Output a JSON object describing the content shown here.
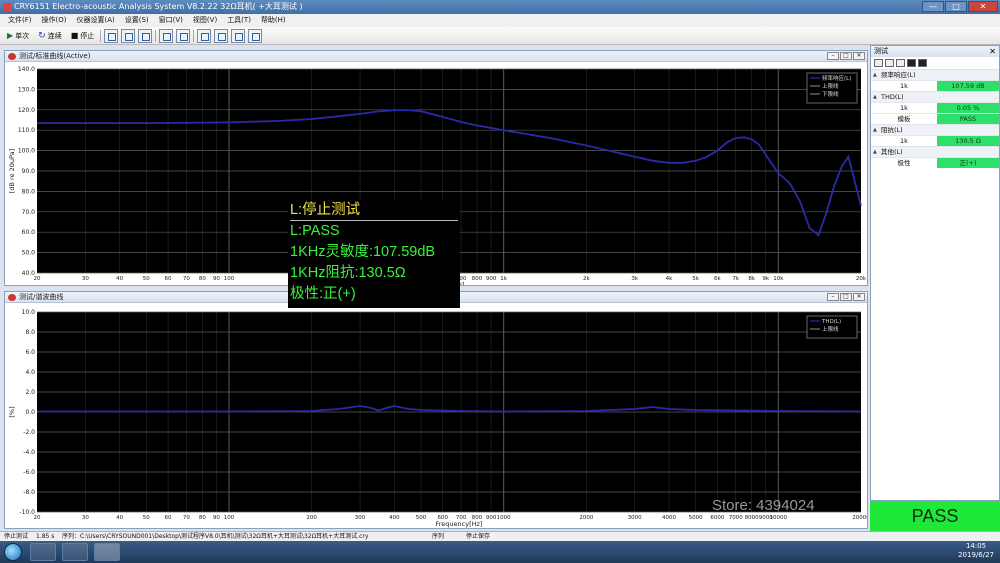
{
  "titlebar": {
    "title": "CRY6151 Electro-acoustic Analysis System  V8.2.22 32Ω耳机( +大耳测试 )",
    "min": "—",
    "max": "□",
    "close": "✕"
  },
  "menu": [
    "文件(F)",
    "操作(O)",
    "仪器设置(A)",
    "设置(S)",
    "窗口(V)",
    "视图(V)",
    "工具(T)",
    "帮助(H)"
  ],
  "toolbar": {
    "single": "单次",
    "continuous": "连续",
    "stop": "停止"
  },
  "panel_top": {
    "title": "测试/标准曲线(Active)",
    "ylabel": "[dB re 20uPa]",
    "xlabel_partial": "Hz]"
  },
  "panel_bottom": {
    "title": "测试/谐波曲线",
    "ylabel": "[%]",
    "xlabel": "Frequency[Hz]"
  },
  "legend_top": [
    "频率响应(L)",
    "上限线",
    "下限线"
  ],
  "legend_bottom": [
    "THD(L)",
    "上限线"
  ],
  "overlay": {
    "line1": "L:停止测试",
    "line2": "L:PASS",
    "line3": "1KHz灵敏度:107.59dB",
    "line4": "1KHz阻抗:130.5Ω",
    "line5": "极性:正(+)"
  },
  "right_panel": {
    "title": "测试",
    "close": "✕",
    "groups": [
      {
        "title": "频率响应(L)",
        "rows": [
          {
            "k": "1k",
            "v": "107.59 dB"
          }
        ]
      },
      {
        "title": "THD(L)",
        "rows": [
          {
            "k": "1k",
            "v": "0.05 %"
          },
          {
            "k": "模板",
            "v": "PASS"
          }
        ]
      },
      {
        "title": "阻抗(L)",
        "rows": [
          {
            "k": "1k",
            "v": "130.5 Ω"
          }
        ]
      },
      {
        "title": "其他(L)",
        "rows": [
          {
            "k": "极性",
            "v": "正(+)"
          }
        ]
      }
    ]
  },
  "pass_label": "PASS",
  "watermark": "Store: 4394024",
  "statusbar": {
    "status": "停止测试",
    "time": "1.85 s",
    "path": "序列：C:\\Users\\CRYSOUND001\\Desktop\\测试程序V8.0\\耳机\\测试\\32Ω耳机+大耳测试\\32Ω耳机+大耳测试.cry",
    "seq": "序列",
    "state": "停止保存"
  },
  "taskbar": {
    "time": "14:05",
    "date": "2019/6/27"
  },
  "colors": {
    "curve": "#2a2aa8",
    "grid_major": "#5a5a5a",
    "grid_minor": "#2c2c2c",
    "pass": "#1ee83a"
  },
  "chart_data": [
    {
      "type": "line",
      "title": "测试/标准曲线(Active)",
      "ylabel": "[dB re 20uPa]",
      "x_scale": "log",
      "xlim": [
        20,
        20000
      ],
      "ylim": [
        40,
        140
      ],
      "yticks": [
        40,
        50,
        60,
        70,
        80,
        90,
        100,
        110,
        120,
        130,
        140
      ],
      "xticks": [
        20,
        30,
        40,
        50,
        60,
        70,
        80,
        90,
        100,
        200,
        300,
        400,
        500,
        600,
        700,
        800,
        900,
        1000,
        2000,
        3000,
        4000,
        5000,
        6000,
        7000,
        8000,
        9000,
        10000,
        20000
      ],
      "xtick_labels": [
        "20",
        "30",
        "40",
        "50",
        "60",
        "70",
        "80",
        "90",
        "100",
        "200",
        "300",
        "400",
        "500",
        "600",
        "700",
        "800",
        "900",
        "1k",
        "2k",
        "3k",
        "4k",
        "5k",
        "6k",
        "7k",
        "8k",
        "9k",
        "10k",
        "20k"
      ],
      "series": [
        {
          "name": "频率响应(L)",
          "x": [
            20,
            50,
            100,
            150,
            200,
            250,
            300,
            350,
            400,
            450,
            500,
            600,
            700,
            800,
            1000,
            1500,
            2000,
            2500,
            3000,
            3500,
            4000,
            4500,
            5000,
            5500,
            6000,
            6500,
            7000,
            7500,
            8000,
            8500,
            9000,
            10000,
            11000,
            12000,
            13000,
            14000,
            15000,
            16000,
            17000,
            18000,
            20000
          ],
          "y": [
            113.5,
            113.5,
            113.8,
            114.5,
            115.5,
            116.8,
            118.0,
            119.2,
            119.8,
            119.8,
            119.3,
            116.5,
            114.0,
            112.3,
            110.0,
            106.0,
            102.5,
            99.5,
            97.0,
            95.0,
            94.0,
            94.0,
            95.0,
            97.0,
            100.0,
            104.0,
            106.2,
            106.5,
            105.5,
            103.0,
            98.0,
            89.0,
            84.0,
            75.0,
            62.0,
            58.5,
            70.0,
            83.0,
            92.0,
            97.0,
            73.0
          ]
        }
      ]
    },
    {
      "type": "line",
      "title": "测试/谐波曲线",
      "xlabel": "Frequency[Hz]",
      "ylabel": "[%]",
      "x_scale": "log",
      "xlim": [
        20,
        20000
      ],
      "ylim": [
        -10,
        10
      ],
      "yticks": [
        -10,
        -8,
        -6,
        -4,
        -2,
        0,
        2,
        4,
        6,
        8,
        10
      ],
      "xticks": [
        20,
        30,
        40,
        50,
        60,
        70,
        80,
        90,
        100,
        200,
        300,
        400,
        500,
        600,
        700,
        800,
        900,
        1000,
        2000,
        3000,
        4000,
        5000,
        6000,
        7000,
        8000,
        9000,
        10000,
        20000
      ],
      "xtick_labels": [
        "20",
        "30",
        "40",
        "50",
        "60",
        "70",
        "80",
        "90",
        "100",
        "200",
        "300",
        "400",
        "500",
        "600",
        "700",
        "800",
        "900",
        "1000",
        "2000",
        "3000",
        "4000",
        "5000",
        "6000",
        "7000",
        "8000",
        "9000",
        "10000",
        "20000"
      ],
      "series": [
        {
          "name": "THD(L)",
          "x": [
            20,
            100,
            200,
            250,
            300,
            330,
            350,
            380,
            400,
            450,
            500,
            700,
            1000,
            2000,
            3000,
            3500,
            4000,
            5000,
            10000,
            20000
          ],
          "y": [
            0.05,
            0.05,
            0.1,
            0.3,
            0.6,
            0.4,
            0.15,
            0.45,
            0.6,
            0.3,
            0.2,
            0.1,
            0.05,
            0.1,
            0.3,
            0.5,
            0.3,
            0.2,
            0.1,
            0.05
          ]
        }
      ]
    }
  ]
}
